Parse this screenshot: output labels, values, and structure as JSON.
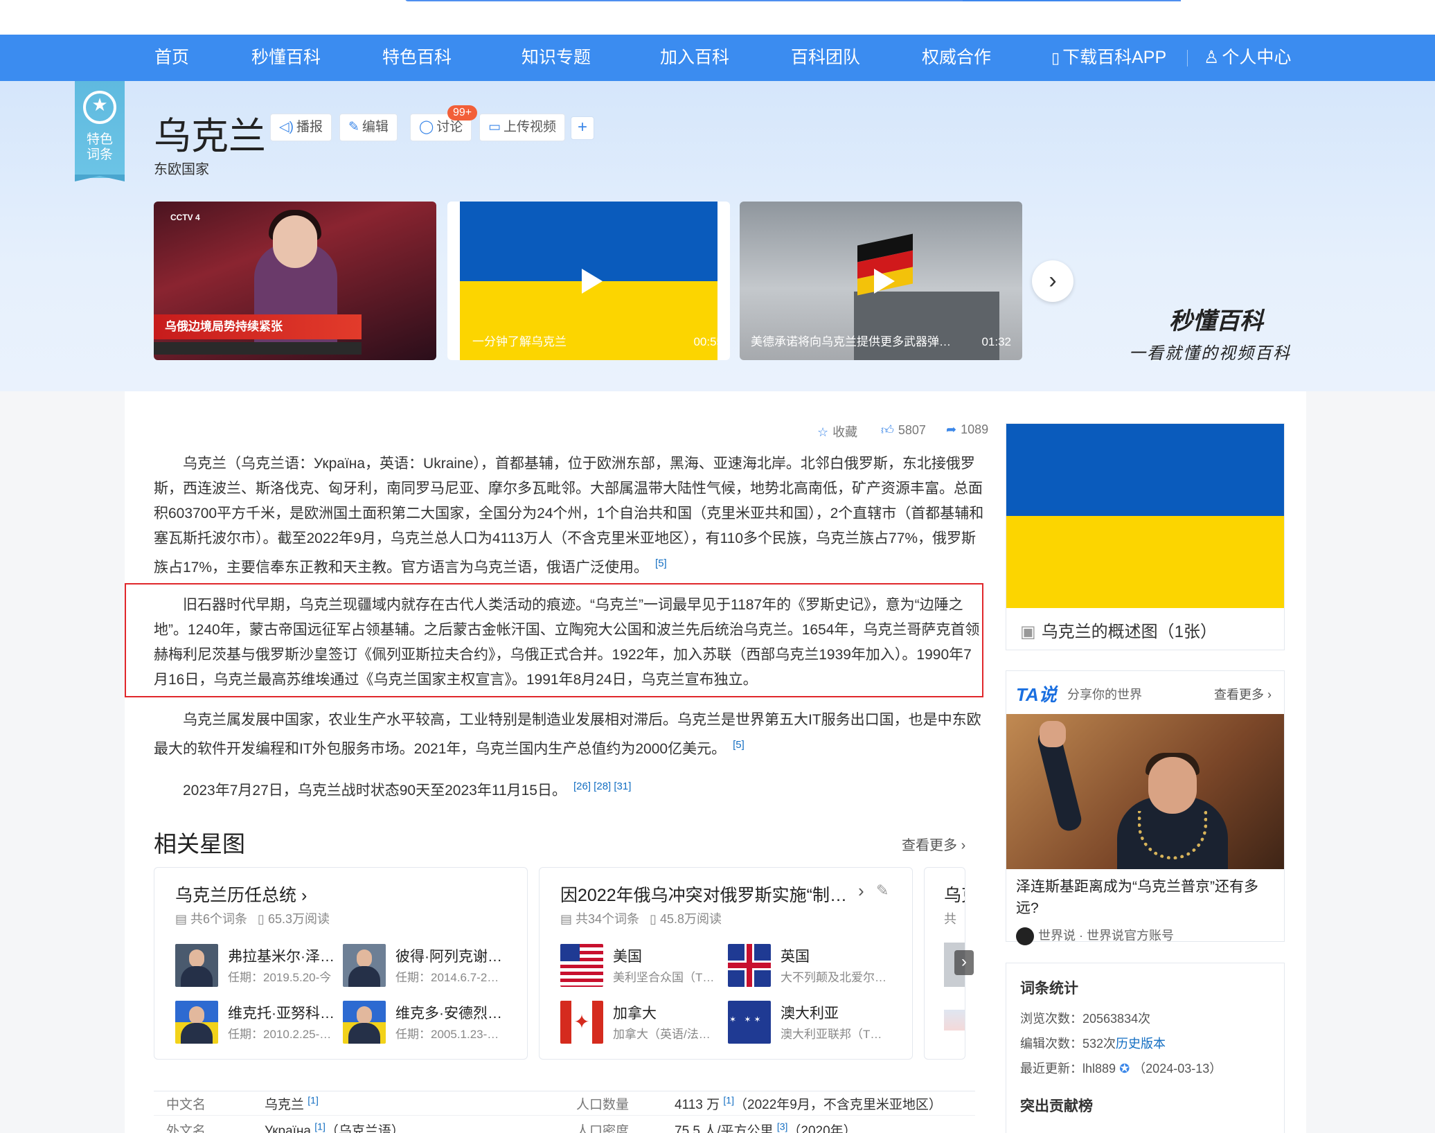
{
  "nav": {
    "items": [
      "首页",
      "秒懂百科",
      "特色百科",
      "知识专题",
      "加入百科",
      "百科团队",
      "权威合作"
    ],
    "download": "下载百科APP",
    "personal": "个人中心"
  },
  "ribbon": {
    "label": "特色\n词条"
  },
  "entry": {
    "title": "乌克兰",
    "subtitle": "东欧国家",
    "actions": {
      "broadcast": "播报",
      "edit": "编辑",
      "discuss": "讨论",
      "upload": "上传视频"
    },
    "discuss_badge": "99+"
  },
  "videos": [
    {
      "caption": "乌俄边境局势持续紧张",
      "duration": ""
    },
    {
      "caption": "一分钟了解乌克兰",
      "duration": "00:55"
    },
    {
      "caption": "美德承诺将向乌克兰提供更多武器弹…",
      "duration": "01:32"
    }
  ],
  "brand": {
    "logo": "秒懂百科",
    "slogan": "一看就懂的视频百科"
  },
  "stats": {
    "favorite": "收藏",
    "likes": "5807",
    "shares": "1089"
  },
  "paragraphs": {
    "p1": "乌克兰（乌克兰语：Україна，英语：Ukraine），首都基辅，位于欧洲东部，黑海、亚速海北岸。北邻白俄罗斯，东北接俄罗斯，西连波兰、斯洛伐克、匈牙利，南同罗马尼亚、摩尔多瓦毗邻。大部属温带大陆性气候，地势北高南低，矿产资源丰富。总面积603700平方千米，是欧洲国土面积第二大国家，全国分为24个州，1个自治共和国（克里米亚共和国），2个直辖市（首都基辅和塞瓦斯托波尔市）。截至2022年9月，乌克兰总人口为4113万人（不含克里米亚地区），有110多个民族，乌克兰族占77%，俄罗斯族占17%，主要信奉东正教和天主教。官方语言为乌克兰语，俄语广泛使用。",
    "p1_ref": "[5]",
    "p2": "旧石器时代早期，乌克兰现疆域内就存在古代人类活动的痕迹。“乌克兰”一词最早见于1187年的《罗斯史记》，意为“边陲之地”。1240年，蒙古帝国远征军占领基辅。之后蒙古金帐汗国、立陶宛大公国和波兰先后统治乌克兰。1654年，乌克兰哥萨克首领赫梅利尼茨基与俄罗斯沙皇签订《佩列亚斯拉夫合约》，乌俄正式合并。1922年，加入苏联（西部乌克兰1939年加入）。1990年7月16日，乌克兰最高苏维埃通过《乌克兰国家主权宣言》。1991年8月24日，乌克兰宣布独立。",
    "p3": "乌克兰属发展中国家，农业生产水平较高，工业特别是制造业发展相对滞后。乌克兰是世界第五大IT服务出口国，也是中东欧最大的软件开发编程和IT外包服务市场。2021年，乌克兰国内生产总值约为2000亿美元。",
    "p3_ref": "[5]",
    "p4": "2023年7月27日，乌克兰战时状态90天至2023年11月15日。",
    "p4_refs": "[26]  [28]  [31]"
  },
  "related": {
    "heading": "相关星图",
    "more": "查看更多",
    "cards": [
      {
        "title": "乌克兰历任总统",
        "meta_count": "共6个词条",
        "meta_reads": "65.3万阅读",
        "entries": [
          {
            "name": "弗拉基米尔·泽…",
            "desc": "任期：2019.5.20-今"
          },
          {
            "name": "彼得·阿列克谢…",
            "desc": "任期：2014.6.7-2…"
          },
          {
            "name": "维克托·亚努科…",
            "desc": "任期：2010.2.25-…"
          },
          {
            "name": "维克多·安德烈…",
            "desc": "任期：2005.1.23-…"
          }
        ]
      },
      {
        "title": "因2022年俄乌冲突对俄罗斯实施“制…",
        "meta_count": "共34个词条",
        "meta_reads": "45.8万阅读",
        "entries": [
          {
            "name": "美国",
            "desc": "美利坚合众国（T…"
          },
          {
            "name": "英国",
            "desc": "大不列颠及北爱尔…"
          },
          {
            "name": "加拿大",
            "desc": "加拿大（英语/法…"
          },
          {
            "name": "澳大利亚",
            "desc": "澳大利亚联邦（T…"
          }
        ]
      },
      {
        "title": "乌克",
        "meta_count": "共"
      }
    ]
  },
  "infobox": [
    {
      "key": "中文名",
      "value": "乌克兰",
      "ref": "[1]"
    },
    {
      "key": "人口数量",
      "value": "4113 万",
      "ref": "[1]",
      "note": "（2022年9月，不含克里米亚地区）"
    },
    {
      "key": "外文名",
      "value": "Україна",
      "ref": "[1]",
      "note": "（乌克兰语）"
    },
    {
      "key": "人口密度",
      "value": "75.5 人/平方公里",
      "ref": "[3]",
      "note": "（2020年）"
    }
  ],
  "sidebar": {
    "image_label": "乌克兰的概述图（1张）",
    "ta": {
      "logo": "TA说",
      "slogan": "分享你的世界",
      "more": "查看更多",
      "headline": "泽连斯基距离成为“乌克兰普京”还有多远?",
      "author": "世界说 · 世界说官方账号"
    },
    "stats": {
      "heading": "词条统计",
      "views_label": "浏览次数：",
      "views": "20563834次",
      "edits_label": "编辑次数：",
      "edits": "532次",
      "history": "历史版本",
      "updated_label": "最近更新：",
      "updated_user": "lhl889",
      "updated_date": "（2024-03-13）",
      "contrib_heading": "突出贡献榜"
    }
  },
  "colors": {
    "nav": "#3b8cf0",
    "link": "#136ec2",
    "ukraine_blue": "#0a5bbc",
    "ukraine_yellow": "#fcd500",
    "highlight_border": "#e0272b"
  }
}
